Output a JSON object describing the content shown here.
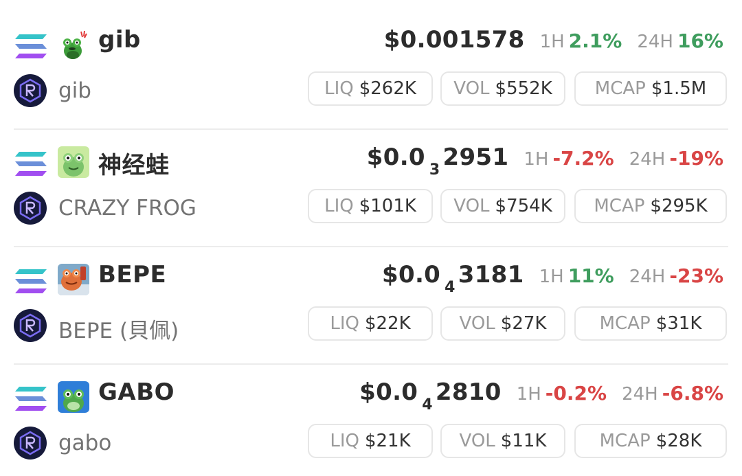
{
  "tokens": [
    {
      "symbol": "gib",
      "name": "gib",
      "price_main": "$0.001578",
      "price_zeros": "",
      "price_tail": "",
      "change_1h_label": "1H",
      "change_1h": "2.1%",
      "change_1h_dir": "up",
      "change_24h_label": "24H",
      "change_24h": "16%",
      "change_24h_dir": "up",
      "liq_label": "LIQ",
      "liq": "$262K",
      "vol_label": "VOL",
      "vol": "$552K",
      "mcap_label": "MCAP",
      "mcap": "$1.5M",
      "icon": "frog-exclaim-icon"
    },
    {
      "symbol": "神经蛙",
      "name": "CRAZY FROG",
      "price_main": "$0.0",
      "price_zeros": "3",
      "price_tail": "2951",
      "change_1h_label": "1H",
      "change_1h": "-7.2%",
      "change_1h_dir": "down",
      "change_24h_label": "24H",
      "change_24h": "-19%",
      "change_24h_dir": "down",
      "liq_label": "LIQ",
      "liq": "$101K",
      "vol_label": "VOL",
      "vol": "$754K",
      "mcap_label": "MCAP",
      "mcap": "$295K",
      "icon": "crazy-frog-icon"
    },
    {
      "symbol": "BEPE",
      "name": "BEPE (貝佩)",
      "price_main": "$0.0",
      "price_zeros": "4",
      "price_tail": "3181",
      "change_1h_label": "1H",
      "change_1h": "11%",
      "change_1h_dir": "up",
      "change_24h_label": "24H",
      "change_24h": "-23%",
      "change_24h_dir": "down",
      "liq_label": "LIQ",
      "liq": "$22K",
      "vol_label": "VOL",
      "vol": "$27K",
      "mcap_label": "MCAP",
      "mcap": "$31K",
      "icon": "orange-frog-icon"
    },
    {
      "symbol": "GABO",
      "name": "gabo",
      "price_main": "$0.0",
      "price_zeros": "4",
      "price_tail": "2810",
      "change_1h_label": "1H",
      "change_1h": "-0.2%",
      "change_1h_dir": "down",
      "change_24h_label": "24H",
      "change_24h": "-6.8%",
      "change_24h_dir": "down",
      "liq_label": "LIQ",
      "liq": "$21K",
      "vol_label": "VOL",
      "vol": "$11K",
      "mcap_label": "MCAP",
      "mcap": "$28K",
      "icon": "blue-frog-icon"
    }
  ],
  "icons": {
    "chain": "solana-icon",
    "dex": "raydium-icon"
  },
  "colors": {
    "up": "#3f9d5e",
    "down": "#d94545",
    "muted": "#9a9a9a",
    "text": "#2c2c2c"
  }
}
